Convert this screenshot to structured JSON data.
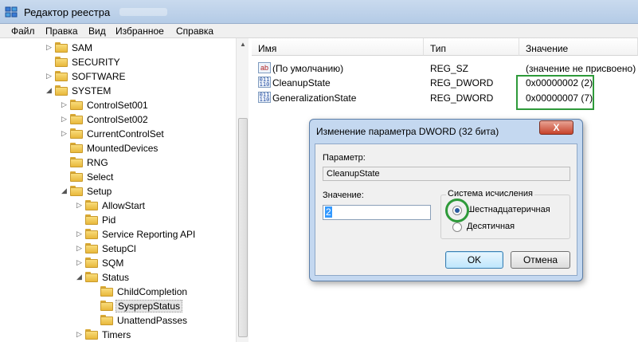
{
  "window": {
    "title": "Редактор реестра"
  },
  "menu": [
    "Файл",
    "Правка",
    "Вид",
    "Избранное",
    "Справка"
  ],
  "tree": [
    {
      "label": "SAM",
      "level": 0,
      "expander": "+"
    },
    {
      "label": "SECURITY",
      "level": 0,
      "expander": ""
    },
    {
      "label": "SOFTWARE",
      "level": 0,
      "expander": "+"
    },
    {
      "label": "SYSTEM",
      "level": 0,
      "expander": "-"
    },
    {
      "label": "ControlSet001",
      "level": 1,
      "expander": "+"
    },
    {
      "label": "ControlSet002",
      "level": 1,
      "expander": "+"
    },
    {
      "label": "CurrentControlSet",
      "level": 1,
      "expander": "+"
    },
    {
      "label": "MountedDevices",
      "level": 1,
      "expander": ""
    },
    {
      "label": "RNG",
      "level": 1,
      "expander": ""
    },
    {
      "label": "Select",
      "level": 1,
      "expander": ""
    },
    {
      "label": "Setup",
      "level": 1,
      "expander": "-"
    },
    {
      "label": "AllowStart",
      "level": 2,
      "expander": "+"
    },
    {
      "label": "Pid",
      "level": 2,
      "expander": ""
    },
    {
      "label": "Service Reporting API",
      "level": 2,
      "expander": "+"
    },
    {
      "label": "SetupCl",
      "level": 2,
      "expander": "+"
    },
    {
      "label": "SQM",
      "level": 2,
      "expander": "+"
    },
    {
      "label": "Status",
      "level": 2,
      "expander": "-"
    },
    {
      "label": "ChildCompletion",
      "level": 3,
      "expander": ""
    },
    {
      "label": "SysprepStatus",
      "level": 3,
      "expander": "",
      "selected": true
    },
    {
      "label": "UnattendPasses",
      "level": 3,
      "expander": ""
    },
    {
      "label": "Timers",
      "level": 2,
      "expander": "+"
    }
  ],
  "columns": {
    "name": "Имя",
    "type": "Тип",
    "data": "Значение"
  },
  "values": [
    {
      "name": "(По умолчанию)",
      "type": "REG_SZ",
      "data": "(значение не присвоено)",
      "icon": "ab"
    },
    {
      "name": "CleanupState",
      "type": "REG_DWORD",
      "data": "0x00000002 (2)",
      "icon": "011"
    },
    {
      "name": "GeneralizationState",
      "type": "REG_DWORD",
      "data": "0x00000007 (7)",
      "icon": "011"
    }
  ],
  "dialog": {
    "title": "Изменение параметра DWORD (32 бита)",
    "close": "X",
    "param_label": "Параметр:",
    "param_value": "CleanupState",
    "value_label": "Значение:",
    "value": "2",
    "base_group": "Система исчисления",
    "base_hex": "Шестнадцатеричная",
    "base_dec": "Десятичная",
    "selected_base": "hex",
    "ok": "OK",
    "cancel": "Отмена"
  }
}
